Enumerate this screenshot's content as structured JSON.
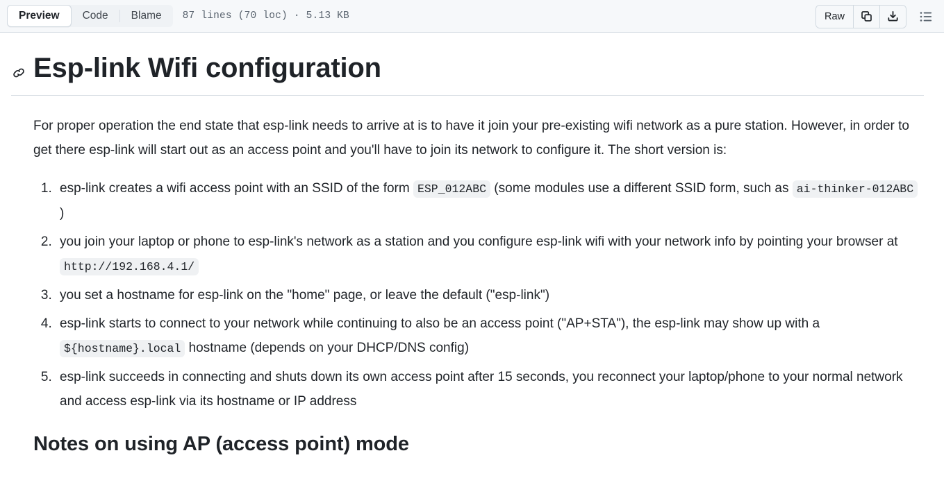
{
  "header": {
    "tabs": [
      {
        "label": "Preview",
        "selected": true
      },
      {
        "label": "Code",
        "selected": false
      },
      {
        "label": "Blame",
        "selected": false
      }
    ],
    "file_meta": "87 lines (70 loc) · 5.13 KB",
    "raw_label": "Raw",
    "icons": {
      "copy": "copy-icon",
      "download": "download-icon",
      "outline": "outline-list-icon"
    }
  },
  "document": {
    "title": "Esp-link Wifi configuration",
    "anchor_icon": "link-icon",
    "intro": "For proper operation the end state that esp-link needs to arrive at is to have it join your pre-existing wifi network as a pure station. However, in order to get there esp-link will start out as an access point and you'll have to join its network to configure it. The short version is:",
    "steps": [
      {
        "parts": [
          {
            "type": "text",
            "value": "esp-link creates a wifi access point with an SSID of the form "
          },
          {
            "type": "code",
            "value": "ESP_012ABC"
          },
          {
            "type": "text",
            "value": " (some modules use a different SSID form, such as "
          },
          {
            "type": "code",
            "value": "ai-thinker-012ABC"
          },
          {
            "type": "text",
            "value": " )"
          }
        ]
      },
      {
        "parts": [
          {
            "type": "text",
            "value": "you join your laptop or phone to esp-link's network as a station and you configure esp-link wifi with your network info by pointing your browser at "
          },
          {
            "type": "code",
            "value": "http://192.168.4.1/"
          }
        ]
      },
      {
        "parts": [
          {
            "type": "text",
            "value": "you set a hostname for esp-link on the \"home\" page, or leave the default (\"esp-link\")"
          }
        ]
      },
      {
        "parts": [
          {
            "type": "text",
            "value": "esp-link starts to connect to your network while continuing to also be an access point (\"AP+STA\"), the esp-link may show up with a "
          },
          {
            "type": "code",
            "value": "${hostname}.local"
          },
          {
            "type": "text",
            "value": " hostname (depends on your DHCP/DNS config)"
          }
        ]
      },
      {
        "parts": [
          {
            "type": "text",
            "value": "esp-link succeeds in connecting and shuts down its own access point after 15 seconds, you reconnect your laptop/phone to your normal network and access esp-link via its hostname or IP address"
          }
        ]
      }
    ],
    "section_heading": "Notes on using AP (access point) mode"
  },
  "colors": {
    "header_bg": "#f6f8fa",
    "border": "#d1d9e0",
    "text": "#1f2328",
    "muted": "#59636e",
    "code_bg": "#eff1f3"
  }
}
